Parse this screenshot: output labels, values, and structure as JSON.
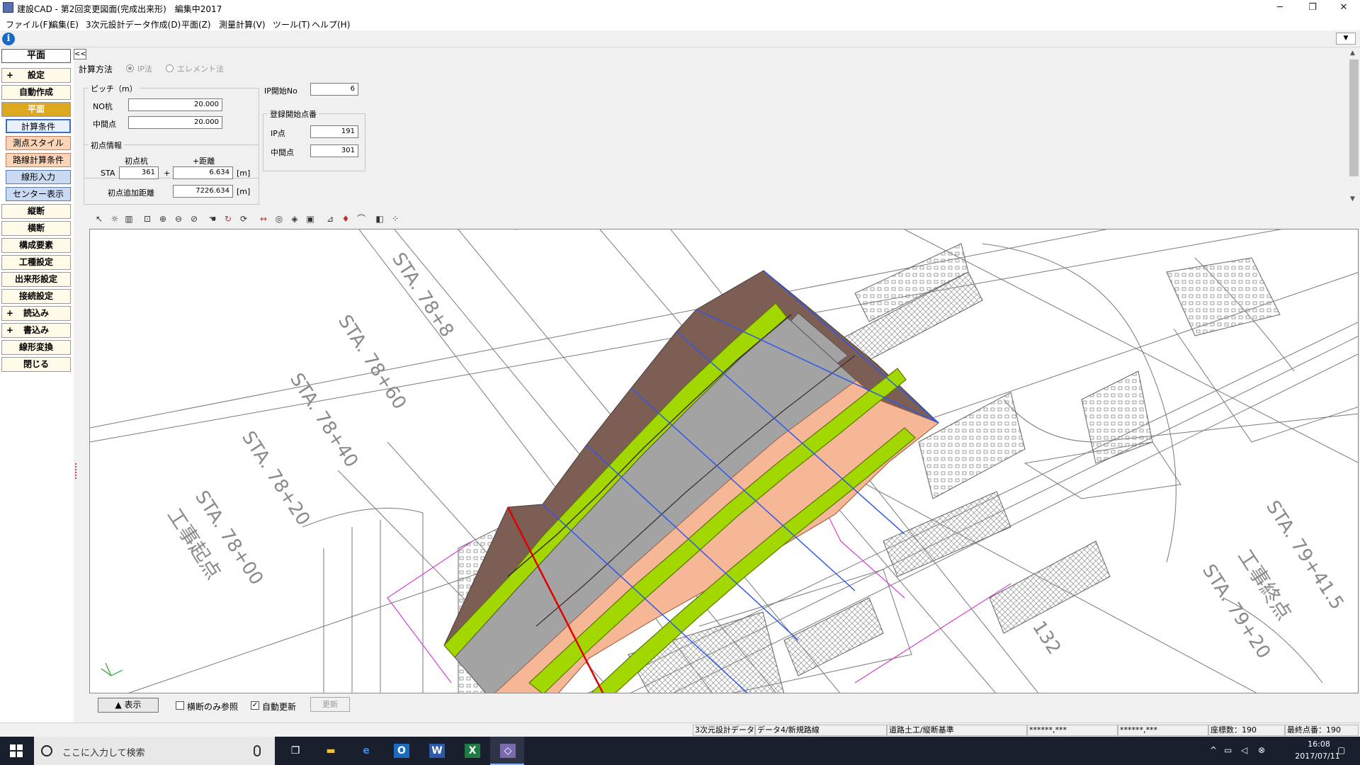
{
  "window": {
    "title": "建設CAD - 第2回変更図面(完成出来形)　編集中2017"
  },
  "menu": [
    "ファイル(F)",
    "編集(E)",
    "3次元設計データ作成(D)",
    "平面(Z)",
    "測量計算(V)",
    "ツール(T)",
    "ヘルプ(H)"
  ],
  "sidebar": {
    "title": "平面",
    "top_items": [
      {
        "label": "設定",
        "plus": "+"
      },
      {
        "label": "自動作成",
        "plus": ""
      },
      {
        "label": "平面",
        "plus": ""
      }
    ],
    "sub_items": [
      "計算条件",
      "測点スタイル",
      "路線計算条件",
      "線形入力",
      "センター表示"
    ],
    "bottom_items": [
      {
        "label": "縦断",
        "plus": ""
      },
      {
        "label": "横断",
        "plus": ""
      },
      {
        "label": "構成要素",
        "plus": ""
      },
      {
        "label": "工種設定",
        "plus": ""
      },
      {
        "label": "出来形設定",
        "plus": ""
      },
      {
        "label": "接続設定",
        "plus": ""
      },
      {
        "label": "読込み",
        "plus": "+"
      },
      {
        "label": "書込み",
        "plus": "+"
      },
      {
        "label": "線形変換",
        "plus": ""
      },
      {
        "label": "閉じる",
        "plus": ""
      }
    ]
  },
  "collapse_label": "<<",
  "settings": {
    "calc_method_label": "計算方法",
    "opt_ip": "IP法",
    "opt_element": "エレメント法",
    "pitch_group": "ピッチ（m）",
    "no_pile_label": "NO杭",
    "no_pile_value": "20.000",
    "mid_label": "中間点",
    "mid_value": "20.000",
    "ip_start_label": "IP開始No",
    "ip_start_value": "6",
    "reg_group": "登録開始点番",
    "ip_point_label": "IP点",
    "ip_point_value": "191",
    "mid_point_label": "中間点",
    "mid_point_value": "301",
    "init_group": "初点情報",
    "init_pile_label": "初点杭",
    "plus_dist_label": "+距離",
    "sta_label": "STA",
    "sta_value": "361",
    "plus_sign": "+",
    "dist_value": "6.634",
    "unit_m": "[m]",
    "init_add_label": "初点追加距離",
    "init_add_value": "7226.634"
  },
  "canvas_labels": {
    "sta_7800": "STA. 78+00",
    "sta_7820": "STA. 78+20",
    "sta_7840": "STA. 78+40",
    "sta_7860": "STA. 78+60",
    "sta_78x": "STA. 78+8",
    "koji_kiten": "工事起点",
    "koji_shuten": "工事終点",
    "sta_7920": "STA. 79+20",
    "sta_794": "STA. 79+41.5",
    "num_132": "132"
  },
  "bottombar": {
    "show_button": "▲ 表示",
    "cross_only_label": "横断のみ参照",
    "auto_update_label": "自動更新",
    "auto_update_checked": "✓",
    "update_button": "更新"
  },
  "status": {
    "s1": "3次元設計データ",
    "s2": "データ4/新規路線",
    "s3": "道路土工/縦断基準",
    "s4": "******,***",
    "s5": "******,***",
    "s6": "座標数：190",
    "s7": "最終点番：190"
  },
  "taskbar": {
    "search_placeholder": "ここに入力して検索",
    "time": "16:08",
    "date": "2017/07/11"
  },
  "colors": {
    "sidebar_active": "#dca820",
    "road_brown": "#7d5e55",
    "road_gray": "#a3a3a3",
    "road_peach": "#f6b796",
    "road_green": "#a3d700",
    "station_line_blue": "#2e59e8",
    "start_line_red": "#e00000"
  }
}
